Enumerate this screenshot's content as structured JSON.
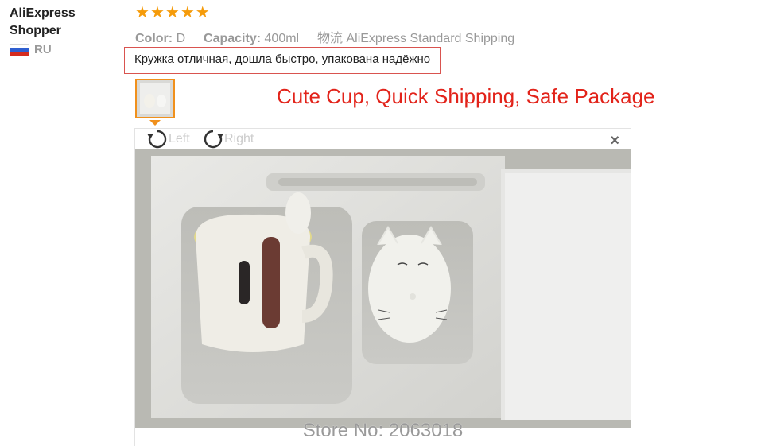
{
  "reviewer": {
    "name": "AliExpress Shopper",
    "country": "RU"
  },
  "rating": {
    "stars": 5,
    "max": 5
  },
  "attributes": {
    "color_label": "Color:",
    "color_value": "D",
    "capacity_label": "Capacity:",
    "capacity_value": "400ml",
    "shipping_prefix": "物流",
    "shipping_value": "AliExpress Standard Shipping"
  },
  "feedback_text": "Кружка отличная, дошла быстро, упакована надёжно",
  "annotation_text": "Cute Cup, Quick Shipping, Safe Package",
  "viewer": {
    "rotate_left_label": "Left",
    "rotate_right_label": "Right",
    "close_symbol": "×",
    "watermark": "Store No: 2063018"
  },
  "colors": {
    "star": "#f59b0a",
    "accent_orange": "#f0901c",
    "annotation_red": "#e2231a"
  }
}
